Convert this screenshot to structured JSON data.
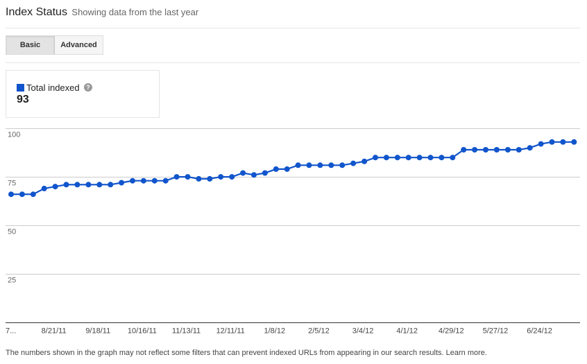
{
  "header": {
    "title": "Index Status",
    "subtitle": "Showing data from the last year"
  },
  "tabs": {
    "basic_label": "Basic",
    "advanced_label": "Advanced",
    "active": "Basic"
  },
  "legend": {
    "series_label": "Total indexed",
    "help_icon": "help-icon",
    "help_glyph": "?",
    "value": "93",
    "color": "#1155cc"
  },
  "footer": {
    "text": "The numbers shown in the graph may not reflect some filters that can prevent indexed URLs from appearing in our search results.",
    "link": "Learn more."
  },
  "chart_data": {
    "type": "line",
    "title": "",
    "xlabel": "",
    "ylabel": "",
    "ylim": [
      0,
      100
    ],
    "yticks": [
      25,
      50,
      75,
      100
    ],
    "grid": true,
    "legend_position": "top-left",
    "point_markers": true,
    "series": [
      {
        "name": "Total indexed",
        "color": "#1155cc",
        "values": [
          66,
          66,
          66,
          69,
          70,
          71,
          71,
          71,
          71,
          71,
          72,
          73,
          73,
          73,
          73,
          75,
          75,
          74,
          74,
          75,
          75,
          77,
          76,
          77,
          79,
          79,
          81,
          81,
          81,
          81,
          81,
          82,
          83,
          85,
          85,
          85,
          85,
          85,
          85,
          85,
          85,
          89,
          89,
          89,
          89,
          89,
          89,
          90,
          92,
          93,
          93,
          93
        ]
      }
    ],
    "x_tick_labels": [
      {
        "index": 0,
        "label": "7..."
      },
      {
        "index": 4,
        "label": "8/21/11"
      },
      {
        "index": 8,
        "label": "9/18/11"
      },
      {
        "index": 12,
        "label": "10/16/11"
      },
      {
        "index": 16,
        "label": "11/13/11"
      },
      {
        "index": 20,
        "label": "12/11/11"
      },
      {
        "index": 24,
        "label": "1/8/12"
      },
      {
        "index": 28,
        "label": "2/5/12"
      },
      {
        "index": 32,
        "label": "3/4/12"
      },
      {
        "index": 36,
        "label": "4/1/12"
      },
      {
        "index": 40,
        "label": "4/29/12"
      },
      {
        "index": 44,
        "label": "5/27/12"
      },
      {
        "index": 48,
        "label": "6/24/12"
      }
    ]
  }
}
